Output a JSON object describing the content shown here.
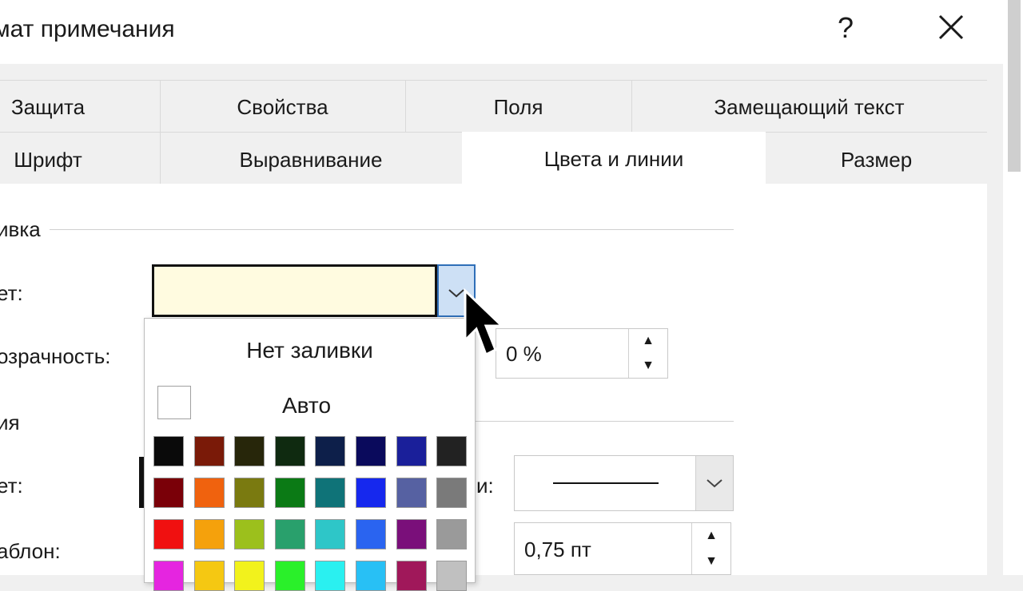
{
  "window": {
    "title": "мат примечания",
    "help_label": "?",
    "close_label": "✕"
  },
  "tabs_row1": [
    "Защита",
    "Свойства",
    "Поля",
    "Замещающий текст"
  ],
  "tabs_row2": [
    "Шрифт",
    "Выравнивание",
    "Цвета и линии",
    "Размер"
  ],
  "active_tab": "Цвета и линии",
  "fill": {
    "group_label": "ивка",
    "color_label": "ет:",
    "color_value_hex": "#fffbe0",
    "transparency_label": "озрачность:",
    "transparency_value": "0 %"
  },
  "line": {
    "group_label": "ия",
    "color_label": "ет:",
    "pattern_label": "аблон:",
    "type_label": "и:",
    "weight_value": "0,75 пт"
  },
  "color_popup": {
    "no_fill_label": "Нет заливки",
    "auto_label": "Авто",
    "rows": [
      [
        "#0a0a0a",
        "#7a1a08",
        "#27260a",
        "#0f2a10",
        "#0d1f4a",
        "#0a0a5c",
        "#1a1f9a",
        "#222222"
      ],
      [
        "#7a0008",
        "#f0620e",
        "#7a7a10",
        "#0b7a15",
        "#0f7378",
        "#1628ee",
        "#5661a2",
        "#7a7a7a"
      ],
      [
        "#f01010",
        "#f5a10c",
        "#9cc01c",
        "#29a06c",
        "#2ec6c8",
        "#2a64f0",
        "#7a0f7a",
        "#9a9a9a"
      ],
      [
        "#e525e0",
        "#f5c812",
        "#f2f21c",
        "#2af02a",
        "#2af0f0",
        "#28c0f5",
        "#a0185a",
        "#c0c0c0"
      ]
    ]
  }
}
